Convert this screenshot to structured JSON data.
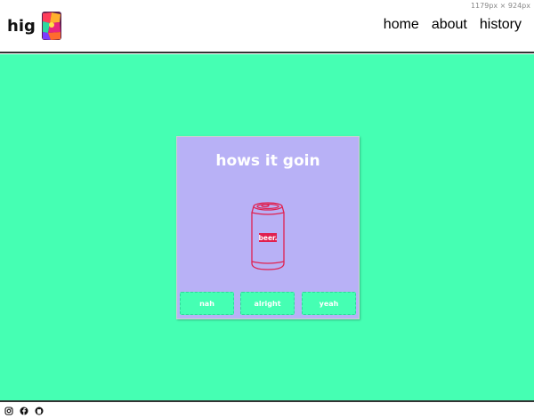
{
  "header": {
    "brand": "hig",
    "nav": [
      "home",
      "about",
      "history"
    ],
    "dimensions_note": "1179px × 924px"
  },
  "card": {
    "title": "hows it goin",
    "can_label": "beer.",
    "buttons": [
      "nah",
      "alright",
      "yeah"
    ]
  },
  "footer": {
    "icons": [
      "instagram-icon",
      "facebook-icon",
      "github-icon"
    ]
  },
  "colors": {
    "background": "#45ffb3",
    "card": "#b8b1f6",
    "can_stroke": "#e0204f"
  }
}
